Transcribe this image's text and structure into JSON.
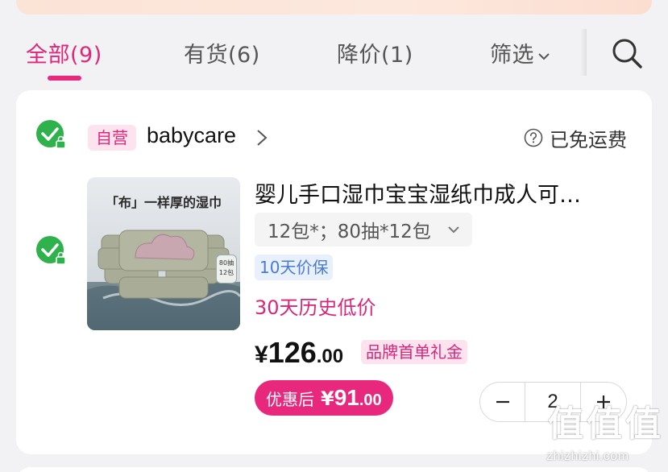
{
  "tabs": [
    {
      "label": "全部(9)",
      "active": true
    },
    {
      "label": "有货(6)",
      "active": false
    },
    {
      "label": "降价(1)",
      "active": false
    },
    {
      "label": "筛选",
      "active": false
    }
  ],
  "search": {
    "icon": "search-icon"
  },
  "store": {
    "self_operated_tag": "自营",
    "name": "babycare",
    "shipping": "已免运费",
    "shipping_icon": "help-icon"
  },
  "product": {
    "image_caption": "「布」一样厚的湿巾",
    "image_badge_line1": "80抽",
    "image_badge_line2": "12包",
    "title": "婴儿手口湿巾宝宝湿纸巾成人可…",
    "spec": "12包*；80抽*12包",
    "price_protect_tag": "10天价保",
    "history_low": "30天历史低价",
    "price_currency": "¥",
    "price_int": "126",
    "price_dec": ".00",
    "gift_tag": "品牌首单礼金",
    "after_discount_label": "优惠后",
    "after_discount_currency": "¥",
    "after_discount_int": "91",
    "after_discount_dec": ".00",
    "quantity": "2"
  },
  "watermark": {
    "logo_chars": [
      "值",
      "值",
      "值"
    ],
    "url": "zhizhizhi.com"
  },
  "colors": {
    "accent": "#e8287c",
    "check_green": "#2fb24c",
    "price_protect_blue": "#4a7bd0"
  }
}
